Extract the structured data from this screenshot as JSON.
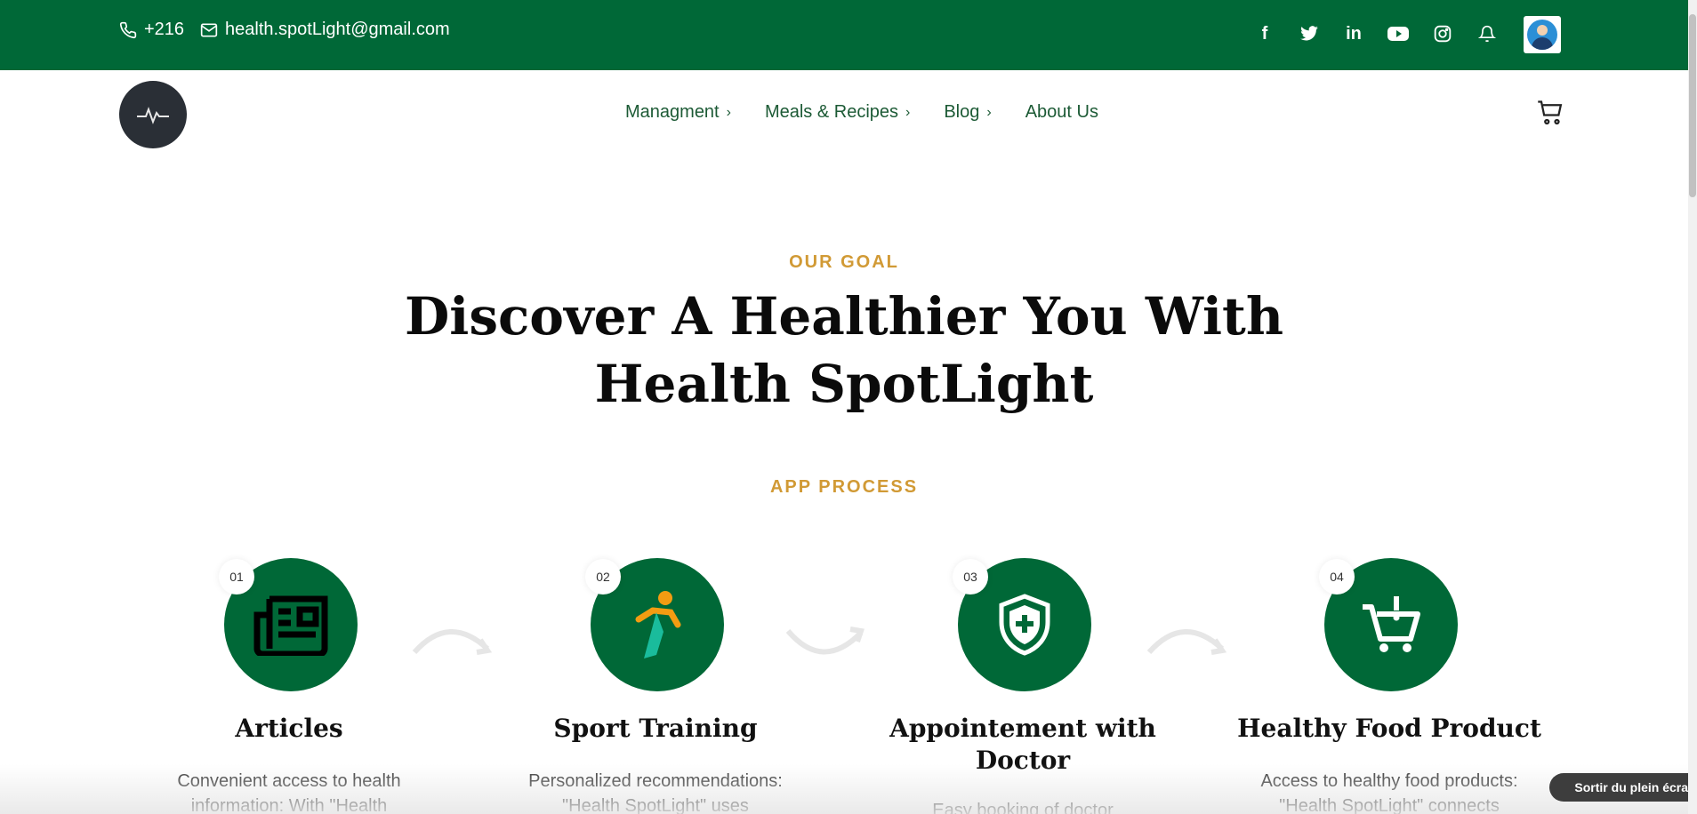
{
  "topbar": {
    "phone": "+216",
    "email": "health.spotLight@gmail.com",
    "socials": [
      {
        "icon": "facebook-icon",
        "glyph": "f"
      },
      {
        "icon": "twitter-icon",
        "glyph": ""
      },
      {
        "icon": "linkedin-icon",
        "glyph": "in"
      },
      {
        "icon": "youtube-icon",
        "glyph": ""
      },
      {
        "icon": "instagram-icon",
        "glyph": ""
      },
      {
        "icon": "bell-icon",
        "glyph": ""
      }
    ],
    "background_color": "#006837"
  },
  "nav": {
    "items": [
      {
        "label": "Managment",
        "has_submenu": true
      },
      {
        "label": "Meals & Recipes",
        "has_submenu": true
      },
      {
        "label": "Blog",
        "has_submenu": true
      },
      {
        "label": "About Us",
        "has_submenu": false
      }
    ],
    "chevron": "›",
    "cart_icon": "cart-icon"
  },
  "hero": {
    "eyebrow": "OUR GOAL",
    "headline": "Discover A Healthier You With Health SpotLight"
  },
  "process": {
    "eyebrow": "APP PROCESS",
    "steps": [
      {
        "number": "01",
        "title": "Articles",
        "desc": "Convenient access to health information: With \"Health",
        "icon": "newspaper-icon"
      },
      {
        "number": "02",
        "title": "Sport Training",
        "desc": "Personalized recommendations: \"Health SpotLight\" uses",
        "icon": "runner-icon"
      },
      {
        "number": "03",
        "title": "Appointement with Doctor",
        "desc": "Easy booking of doctor",
        "icon": "medical-shield-icon"
      },
      {
        "number": "04",
        "title": "Healthy Food Product",
        "desc": "Access to healthy food products: \"Health SpotLight\" connects",
        "icon": "shopping-cart-icon"
      }
    ]
  },
  "overlay": {
    "exit_fullscreen": "Sortir du plein écran"
  },
  "colors": {
    "brand_green": "#006837",
    "accent_gold": "#d19a35",
    "nav_text": "#1c5a35"
  }
}
